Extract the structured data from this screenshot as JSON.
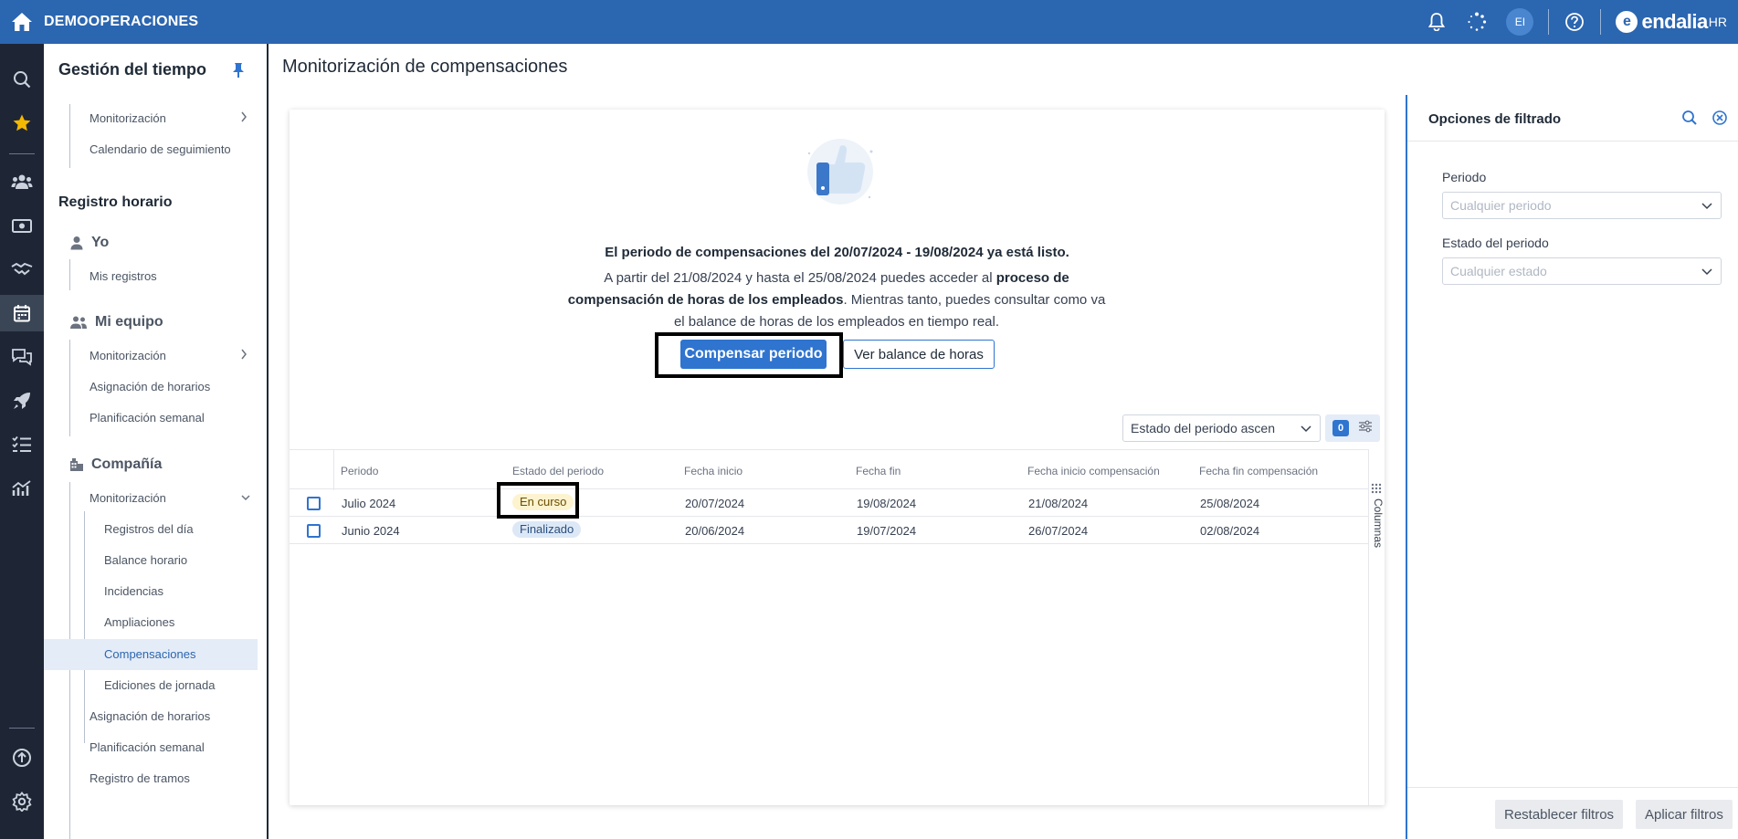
{
  "topbar": {
    "company": "DEMOOPERACIONES",
    "avatar_initials": "EI",
    "logo_text": "endalia",
    "logo_suffix": "HR",
    "logo_mark": "e"
  },
  "sidebar": {
    "title": "Gestión del tiempo",
    "monitorizacion_top": "Monitorización",
    "calendario": "Calendario de seguimiento",
    "registro_horario": "Registro horario",
    "yo": "Yo",
    "mis_registros": "Mis registros",
    "mi_equipo": "Mi equipo",
    "equipo_monitorizacion": "Monitorización",
    "equipo_asignacion": "Asignación de horarios",
    "equipo_planificacion": "Planificación semanal",
    "compania": "Compañía",
    "compania_monitorizacion": "Monitorización",
    "registros_dia": "Registros del día",
    "balance_horario": "Balance horario",
    "incidencias": "Incidencias",
    "ampliaciones": "Ampliaciones",
    "compensaciones": "Compensaciones",
    "ediciones_jornada": "Ediciones de jornada",
    "compania_asignacion": "Asignación de horarios",
    "compania_planificacion": "Planificación semanal",
    "registro_tramos": "Registro de tramos"
  },
  "main": {
    "page_title": "Monitorización de compensaciones",
    "banner_title": "El periodo de compensaciones del 20/07/2024 - 19/08/2024 ya está listo.",
    "banner_text_1": "A partir del 21/08/2024 y hasta el 25/08/2024 puedes acceder al ",
    "banner_text_bold": "proceso de compensación de horas de los empleados",
    "banner_text_2": ". Mientras tanto, puedes consultar como va el balance de horas de los empleados en tiempo real.",
    "compensar_button": "Compensar periodo",
    "balance_button": "Ver balance de horas",
    "sort_value": "Estado del periodo ascen",
    "filter_count": "0",
    "columns_tab": "Columnas"
  },
  "table": {
    "headers": [
      "Periodo",
      "Estado del periodo",
      "Fecha inicio",
      "Fecha fin",
      "Fecha inicio compensación",
      "Fecha fin compensación"
    ],
    "rows": [
      {
        "periodo": "Julio 2024",
        "estado": "En curso",
        "inicio": "20/07/2024",
        "fin": "19/08/2024",
        "inicio_comp": "21/08/2024",
        "fin_comp": "25/08/2024"
      },
      {
        "periodo": "Junio 2024",
        "estado": "Finalizado",
        "inicio": "20/06/2024",
        "fin": "19/07/2024",
        "inicio_comp": "26/07/2024",
        "fin_comp": "02/08/2024"
      }
    ]
  },
  "filters": {
    "title": "Opciones de filtrado",
    "periodo_label": "Periodo",
    "periodo_placeholder": "Cualquier periodo",
    "estado_label": "Estado del periodo",
    "estado_placeholder": "Cualquier estado",
    "reset_button": "Restablecer filtros",
    "apply_button": "Aplicar filtros"
  },
  "colors": {
    "topbar": "#2b66b0",
    "rail": "#1e2636",
    "accent": "#2f74cf",
    "status_en_curso": "#fdf3cf",
    "status_finalizado": "#dde8f6"
  }
}
